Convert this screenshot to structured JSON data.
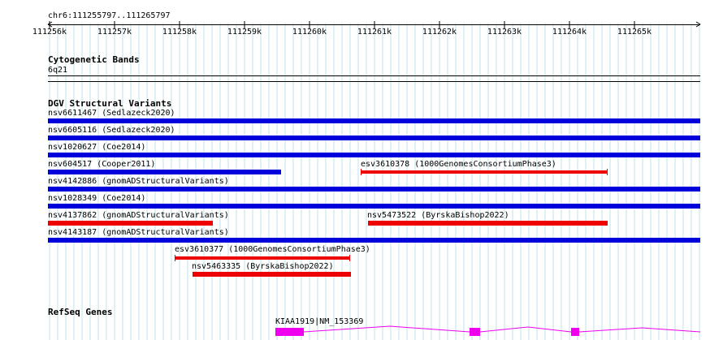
{
  "location": "chr6:111255797..111265797",
  "ruler": {
    "ticks": [
      "111256k",
      "111257k",
      "111258k",
      "111259k",
      "111260k",
      "111261k",
      "111262k",
      "111263k",
      "111264k",
      "111265k"
    ]
  },
  "tracks": {
    "cytoband": {
      "title": "Cytogenetic Bands",
      "band": "6q21"
    },
    "dgv": {
      "title": "DGV Structural Variants",
      "features": [
        {
          "label": "nsv6611467 (Sedlazeck2020)",
          "color": "#0000dd"
        },
        {
          "label": "nsv6605116 (Sedlazeck2020)",
          "color": "#0000dd"
        },
        {
          "label": "nsv1020627 (Coe2014)",
          "color": "#0000dd"
        },
        {
          "label": "nsv604517 (Cooper2011)",
          "color": "#0000dd"
        },
        {
          "label": "esv3610378 (1000GenomesConsortiumPhase3)",
          "color": "#ee0000"
        },
        {
          "label": "nsv4142886 (gnomADStructuralVariants)",
          "color": "#0000dd"
        },
        {
          "label": "nsv1028349 (Coe2014)",
          "color": "#0000dd"
        },
        {
          "label": "nsv4137862 (gnomADStructuralVariants)",
          "color": "#ee0000"
        },
        {
          "label": "nsv5473522 (ByrskaBishop2022)",
          "color": "#ee0000"
        },
        {
          "label": "nsv4143187 (gnomADStructuralVariants)",
          "color": "#0000dd"
        },
        {
          "label": "esv3610377 (1000GenomesConsortiumPhase3)",
          "color": "#ee0000"
        },
        {
          "label": "nsv5463335 (ByrskaBishop2022)",
          "color": "#ee0000"
        }
      ]
    },
    "refseq": {
      "title": "RefSeq Genes",
      "gene_label": "KIAA1919|NM_153369",
      "color": "#ee00ee"
    }
  }
}
